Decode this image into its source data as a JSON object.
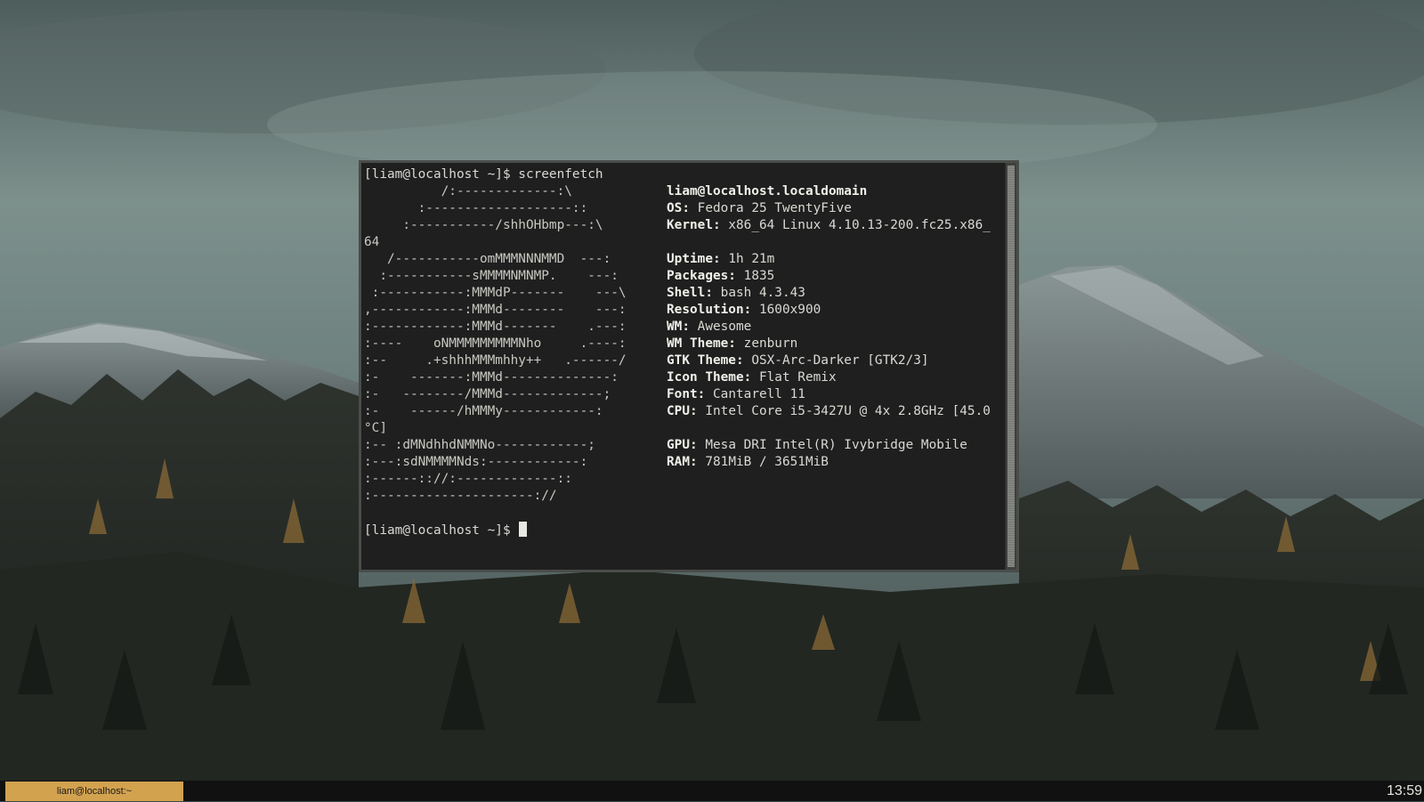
{
  "terminal": {
    "prompt_command": "[liam@localhost ~]$ screenfetch",
    "ascii_art": [
      "          /:-------------:\\",
      "       :-------------------::",
      "     :-----------/shhOHbmp---:\\",
      "64",
      "   /-----------omMMMNNNMMD  ---:",
      "  :-----------sMMMMNMNMP.    ---:",
      " :-----------:MMMdP-------    ---\\",
      ",------------:MMMd--------    ---:",
      ":------------:MMMd-------    .---:",
      ":----    oNMMMMMMMMMNho     .----:",
      ":--     .+shhhMMMmhhy++   .------/",
      ":-    -------:MMMd--------------:",
      ":-   --------/MMMd-------------;",
      ":-    ------/hMMMy------------:",
      "°C]",
      ":-- :dMNdhhdNMMNo------------;",
      ":---:sdNMMMMNds:------------:",
      ":------:://:-------------::",
      ":---------------------://"
    ],
    "info_host": "liam@localhost.localdomain",
    "info": [
      {
        "label": "OS:",
        "value": "Fedora 25 TwentyFive"
      },
      {
        "label": "Kernel:",
        "value": "x86_64 Linux 4.10.13-200.fc25.x86_"
      },
      {
        "label": "Uptime:",
        "value": "1h 21m"
      },
      {
        "label": "Packages:",
        "value": "1835"
      },
      {
        "label": "Shell:",
        "value": "bash 4.3.43"
      },
      {
        "label": "Resolution:",
        "value": "1600x900"
      },
      {
        "label": "WM:",
        "value": "Awesome"
      },
      {
        "label": "WM Theme:",
        "value": "zenburn"
      },
      {
        "label": "GTK Theme:",
        "value": "OSX-Arc-Darker [GTK2/3]"
      },
      {
        "label": "Icon Theme:",
        "value": "Flat Remix"
      },
      {
        "label": "Font:",
        "value": "Cantarell 11"
      },
      {
        "label": "CPU:",
        "value": "Intel Core i5-3427U @ 4x 2.8GHz [45.0"
      },
      {
        "label": "GPU:",
        "value": "Mesa DRI Intel(R) Ivybridge Mobile"
      },
      {
        "label": "RAM:",
        "value": "781MiB / 3651MiB"
      }
    ],
    "final_prompt": "[liam@localhost ~]$ "
  },
  "taskbar": {
    "task_label": "liam@localhost:~",
    "clock": "13:59",
    "accent_color": "#d2a24f"
  }
}
